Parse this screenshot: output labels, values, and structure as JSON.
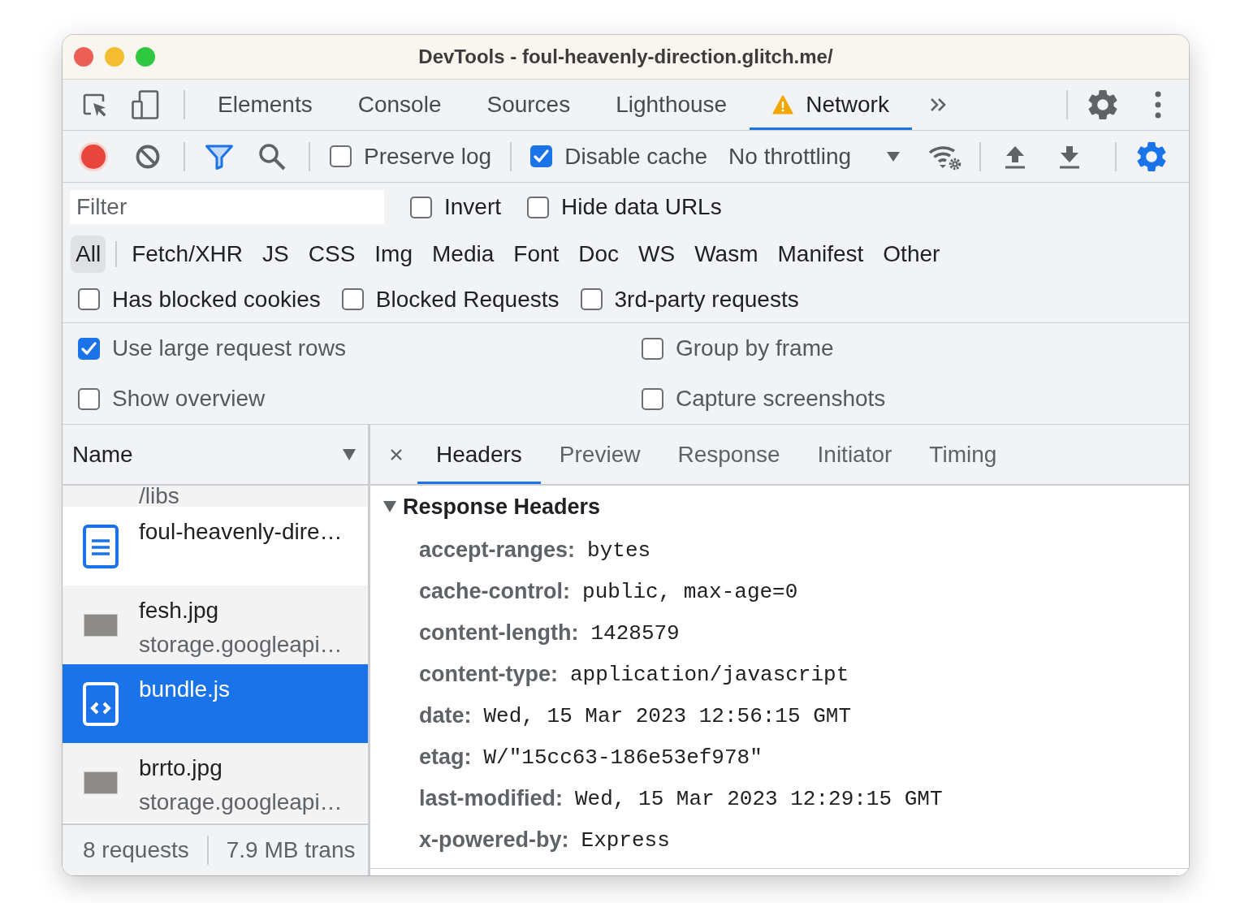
{
  "window": {
    "title": "DevTools - foul-heavenly-direction.glitch.me/"
  },
  "main_tabs": [
    {
      "label": "Elements",
      "selected": false,
      "warning": false
    },
    {
      "label": "Console",
      "selected": false,
      "warning": false
    },
    {
      "label": "Sources",
      "selected": false,
      "warning": false
    },
    {
      "label": "Lighthouse",
      "selected": false,
      "warning": false
    },
    {
      "label": "Network",
      "selected": true,
      "warning": true
    }
  ],
  "toolbar": {
    "recording": true,
    "checkboxes": [
      {
        "label": "Preserve log",
        "checked": false
      },
      {
        "label": "Disable cache",
        "checked": true
      }
    ],
    "throttling": "No throttling"
  },
  "filter": {
    "placeholder": "Filter",
    "options": [
      {
        "label": "Invert",
        "checked": false
      },
      {
        "label": "Hide data URLs",
        "checked": false
      }
    ]
  },
  "type_filters": [
    {
      "label": "All",
      "selected": true
    },
    {
      "label": "Fetch/XHR",
      "selected": false
    },
    {
      "label": "JS",
      "selected": false
    },
    {
      "label": "CSS",
      "selected": false
    },
    {
      "label": "Img",
      "selected": false
    },
    {
      "label": "Media",
      "selected": false
    },
    {
      "label": "Font",
      "selected": false
    },
    {
      "label": "Doc",
      "selected": false
    },
    {
      "label": "WS",
      "selected": false
    },
    {
      "label": "Wasm",
      "selected": false
    },
    {
      "label": "Manifest",
      "selected": false
    },
    {
      "label": "Other",
      "selected": false
    }
  ],
  "extra_filters": [
    {
      "label": "Has blocked cookies",
      "checked": false
    },
    {
      "label": "Blocked Requests",
      "checked": false
    },
    {
      "label": "3rd-party requests",
      "checked": false
    }
  ],
  "settings": [
    {
      "label": "Use large request rows",
      "checked": true
    },
    {
      "label": "Group by frame",
      "checked": false
    },
    {
      "label": "Show overview",
      "checked": false
    },
    {
      "label": "Capture screenshots",
      "checked": false
    }
  ],
  "requests": {
    "column": "Name",
    "partial_row": "/libs",
    "rows": [
      {
        "kind": "document",
        "name": "foul-heavenly-dire…",
        "selected": false
      },
      {
        "kind": "image",
        "name": "fesh.jpg",
        "domain": "storage.googleapi…",
        "selected": false
      },
      {
        "kind": "script",
        "name": "bundle.js",
        "selected": true
      },
      {
        "kind": "image",
        "name": "brrto.jpg",
        "domain": "storage.googleapi…",
        "selected": false
      }
    ]
  },
  "status_bar": [
    "8 requests",
    "7.9 MB trans"
  ],
  "details": {
    "tabs": [
      {
        "label": "Headers",
        "selected": true
      },
      {
        "label": "Preview",
        "selected": false
      },
      {
        "label": "Response",
        "selected": false
      },
      {
        "label": "Initiator",
        "selected": false
      },
      {
        "label": "Timing",
        "selected": false
      }
    ],
    "section": {
      "title": "Response Headers",
      "expanded": true,
      "headers": [
        {
          "name": "accept-ranges:",
          "value": "bytes"
        },
        {
          "name": "cache-control:",
          "value": "public, max-age=0"
        },
        {
          "name": "content-length:",
          "value": "1428579"
        },
        {
          "name": "content-type:",
          "value": "application/javascript"
        },
        {
          "name": "date:",
          "value": "Wed, 15 Mar 2023 12:56:15 GMT"
        },
        {
          "name": "etag:",
          "value": "W/\"15cc63-186e53ef978\""
        },
        {
          "name": "last-modified:",
          "value": "Wed, 15 Mar 2023 12:29:15 GMT"
        },
        {
          "name": "x-powered-by:",
          "value": "Express"
        }
      ]
    }
  }
}
